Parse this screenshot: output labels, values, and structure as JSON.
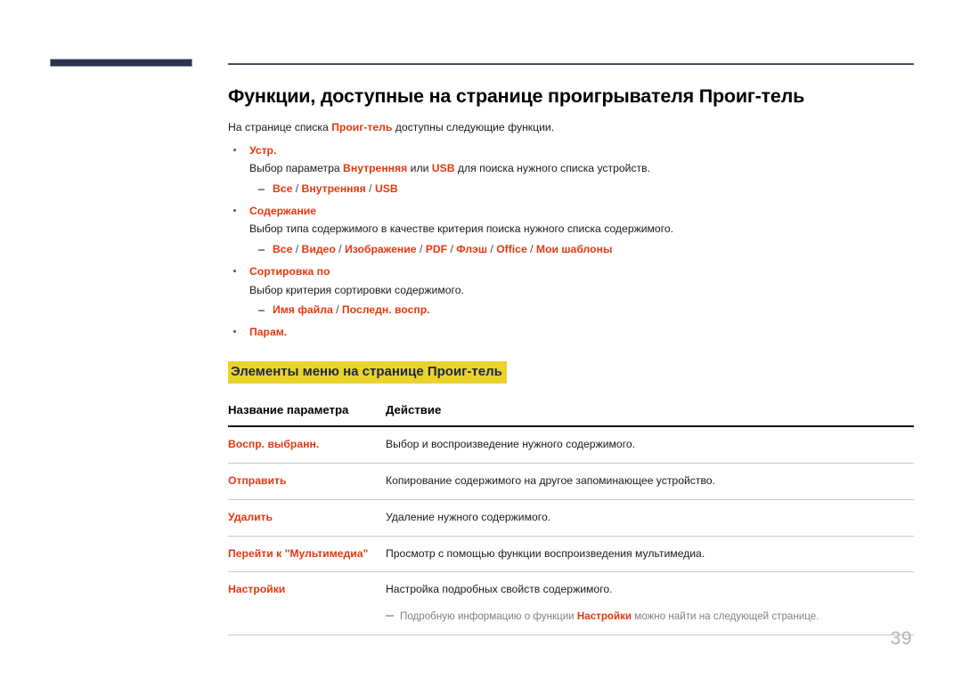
{
  "page": {
    "number": "39"
  },
  "header": {
    "title": "Функции, доступные на странице проигрывателя Проиг-тель",
    "intro": {
      "before": "На странице списка ",
      "highlight": "Проиг-тель",
      "after": " доступны следующие функции."
    }
  },
  "features": [
    {
      "name": "Устр.",
      "description": {
        "before": "Выбор параметра ",
        "highlight1": "Внутренняя",
        "middle": " или ",
        "highlight2": "USB",
        "after": " для поиска нужного списка устройств."
      },
      "options": [
        "Все",
        "Внутренняя",
        "USB"
      ]
    },
    {
      "name": "Содержание",
      "description": {
        "before": "Выбор типа содержимого в качестве критерия поиска нужного списка содержимого.",
        "highlight1": "",
        "middle": "",
        "highlight2": "",
        "after": ""
      },
      "options": [
        "Все",
        "Видео",
        "Изображение",
        "PDF",
        "Флэш",
        "Office",
        "Мои шаблоны"
      ]
    },
    {
      "name": "Сортировка по",
      "description": {
        "before": "Выбор критерия сортировки содержимого.",
        "highlight1": "",
        "middle": "",
        "highlight2": "",
        "after": ""
      },
      "options": [
        "Имя файла",
        "Последн. воспр."
      ]
    },
    {
      "name": "Парам.",
      "description": null,
      "options": []
    }
  ],
  "section": {
    "heading": "Элементы меню на странице Проиг-тель"
  },
  "table": {
    "columns": [
      "Название параметра",
      "Действие"
    ],
    "rows": [
      {
        "name": "Воспр. выбранн.",
        "description": "Выбор и воспроизведение нужного содержимого.",
        "note": null
      },
      {
        "name": "Отправить",
        "description": "Копирование содержимого на другое запоминающее устройство.",
        "note": null
      },
      {
        "name": "Удалить",
        "description": "Удаление нужного содержимого.",
        "note": null
      },
      {
        "name": "Перейти к \"Мультимедиа\"",
        "description": "Просмотр с помощью функции воспроизведения мультимедиа.",
        "note": null
      },
      {
        "name": "Настройки",
        "description": "Настройка подробных свойств содержимого.",
        "note": {
          "before": "Подробную информацию о функции ",
          "highlight": "Настройки",
          "after": " можно найти на следующей странице."
        }
      }
    ]
  },
  "colors": {
    "accent_orange": "#e5380f",
    "highlight_yellow": "#e9d32b",
    "navy": "#2b3350",
    "heading_navy": "#1f2744",
    "page_number_gray": "#b4b4b4"
  }
}
